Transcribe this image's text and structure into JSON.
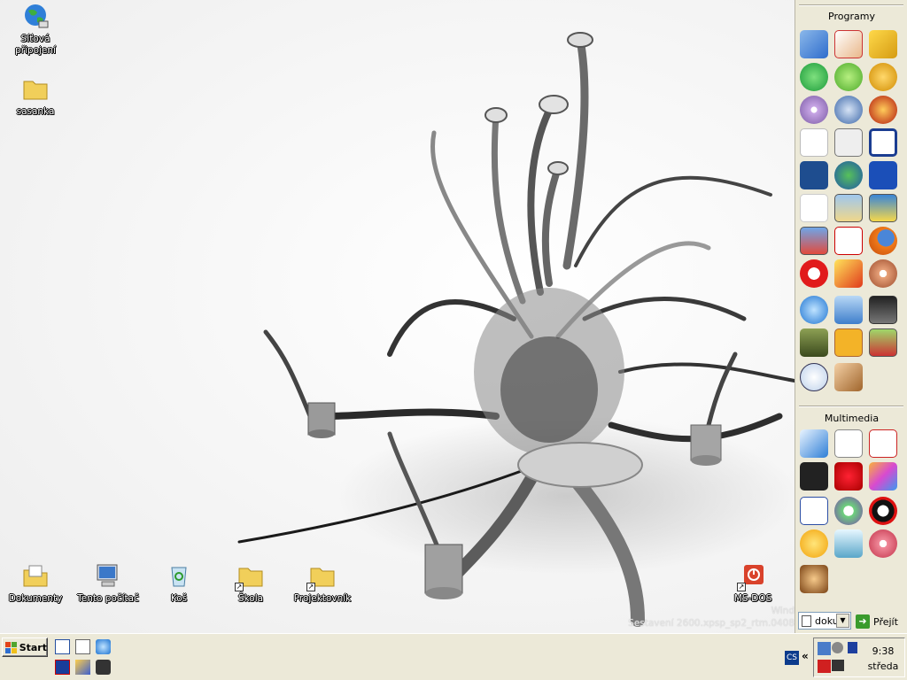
{
  "desktop": {
    "icons_top": [
      {
        "label_lines": [
          "Síťová",
          "připojení"
        ]
      },
      {
        "label_lines": [
          "sasanka"
        ]
      }
    ],
    "icons_bottom": [
      {
        "label": "Dokumenty"
      },
      {
        "label": "Tento počítač"
      },
      {
        "label": "Koš"
      },
      {
        "label": "Škola"
      },
      {
        "label": "Projektovník"
      },
      {
        "label": "MS-DOS"
      }
    ],
    "watermark": {
      "line1": "Wind",
      "line2": "Sestavení 2600.xpsp_sp2_rtm.0408"
    }
  },
  "sidebar": {
    "groups": [
      {
        "title": "Programy"
      },
      {
        "title": "Multimedia"
      }
    ],
    "address_value": "doku",
    "go_label": "Přejít"
  },
  "taskbar": {
    "start_label": "Start",
    "lang": "CS",
    "chevron": "«",
    "clock_time": "9:38",
    "clock_day": "středa"
  },
  "colors": {
    "sidebar_bg": "#ece9d8",
    "taskbar_bg": "#ece9d8",
    "desktop_bg": "#f4f4f4"
  }
}
